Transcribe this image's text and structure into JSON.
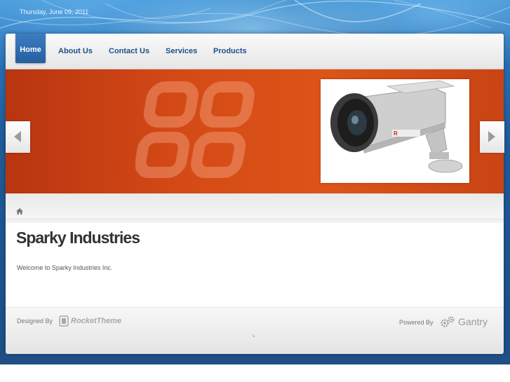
{
  "header": {
    "date": "Thursday, June 09, 2011"
  },
  "nav": {
    "items": [
      {
        "label": "Home",
        "active": true
      },
      {
        "label": "About Us"
      },
      {
        "label": "Contact Us"
      },
      {
        "label": "Services"
      },
      {
        "label": "Products"
      }
    ]
  },
  "slider": {
    "image": "security-camera-image",
    "image_label": "R",
    "prev": "left-arrow-icon",
    "next": "right-arrow-icon"
  },
  "breadcrumb": {
    "icon": "home-icon"
  },
  "main": {
    "title": "Sparky Industries",
    "welcome": "Welcome to Sparky Industries Inc."
  },
  "footer": {
    "designed_by": "Designed By",
    "designer_logo": "RocketTheme",
    "powered_by": "Powered By",
    "powered_logo": "Gantry",
    "pager": "s"
  },
  "colors": {
    "nav_active": "#2f6fb2",
    "nav_text": "#1d4f8a",
    "slider_orange": "#d44a16"
  }
}
